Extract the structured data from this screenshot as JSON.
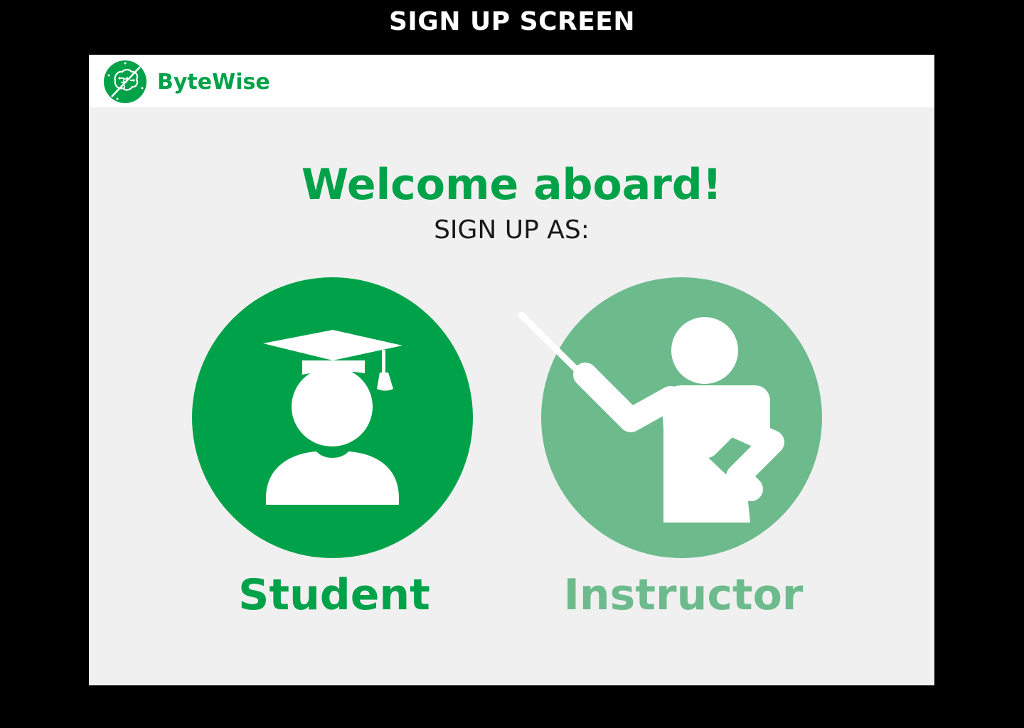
{
  "caption": "SIGN UP SCREEN",
  "app": {
    "name": "ByteWise",
    "logo_icon": "brain-circuit-logo",
    "accent_color": "#00a249",
    "accent_light_color": "#6dbb8d"
  },
  "welcome": {
    "title": "Welcome aboard!",
    "subtitle": "SIGN UP AS:"
  },
  "roles": [
    {
      "label": "Student",
      "icon": "graduate-icon",
      "color": "#00a249",
      "selected": true
    },
    {
      "label": "Instructor",
      "icon": "teacher-pointer-icon",
      "color": "#6dbb8d",
      "selected": false
    }
  ]
}
